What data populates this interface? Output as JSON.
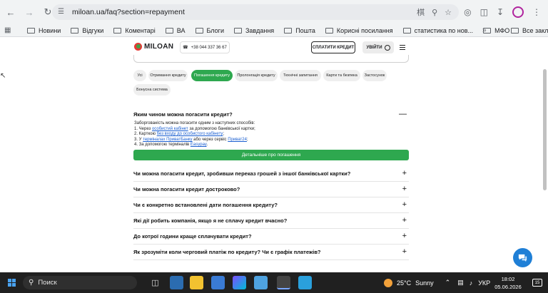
{
  "browser": {
    "url": "miloan.ua/faq?section=repayment",
    "bookmarks": [
      "Новини",
      "Відгуки",
      "Коментарі",
      "ВА",
      "Блоги",
      "Завдання",
      "Пошта",
      "Корисні посилання",
      "статистика по нов...",
      "МФО"
    ],
    "all_bookmarks": "Все закладки"
  },
  "site": {
    "logo": "MILOAN",
    "phone": "+38 044 337 36 67",
    "pay_button": "СПЛАТИТИ КРЕДИТ",
    "login_button": "УВІЙТИ"
  },
  "chips": [
    "Усі",
    "Отримання кредиту",
    "Погашення кредиту",
    "Пролонгація кредиту",
    "Технічні запитання",
    "Карти та безпека",
    "Застосунок",
    "Бонусна система"
  ],
  "faq": {
    "open_question": "Яким чином можна погасити кредит?",
    "answer": {
      "intro": "Заборгованість можна погасити одним з наступних способів:",
      "l1_pre": "1. Через ",
      "l1_link": "особистий кабінет",
      "l1_post": " за допомогою банківської картки;",
      "l2_pre": "2. Карткою ",
      "l2_link": "без входу до особистого кабінету",
      "l2_post": ";",
      "l3_pre": "3. У ",
      "l3_link1": "терміналах ПриватБанку",
      "l3_mid": " або через сервіс ",
      "l3_link2": "Приват24",
      "l3_post": ";",
      "l4_pre": "4. За допомогою терміналів ",
      "l4_link": "Easypay",
      "l4_post": "."
    },
    "details_button": "Детальніше про погашення",
    "questions": [
      "Чи можна погасити кредит, зробивши переказ грошей з іншої банківської картки?",
      "Чи можна погасити кредит достроково?",
      "Чи є конкретно встановлені дати погашення кредиту?",
      "Які дії робить компанія, якщо я не сплачу кредит вчасно?",
      "До котрої години краще сплачувати кредит?",
      "Як зрозуміти коли черговий платіж по кредиту? Чи є графік платежів?"
    ]
  },
  "taskbar": {
    "search": "Поиск",
    "temperature": "25°C",
    "weather": "Sunny",
    "lang": "УКР",
    "time": "18:02",
    "date": "05.06.2026",
    "notifications": "15"
  }
}
